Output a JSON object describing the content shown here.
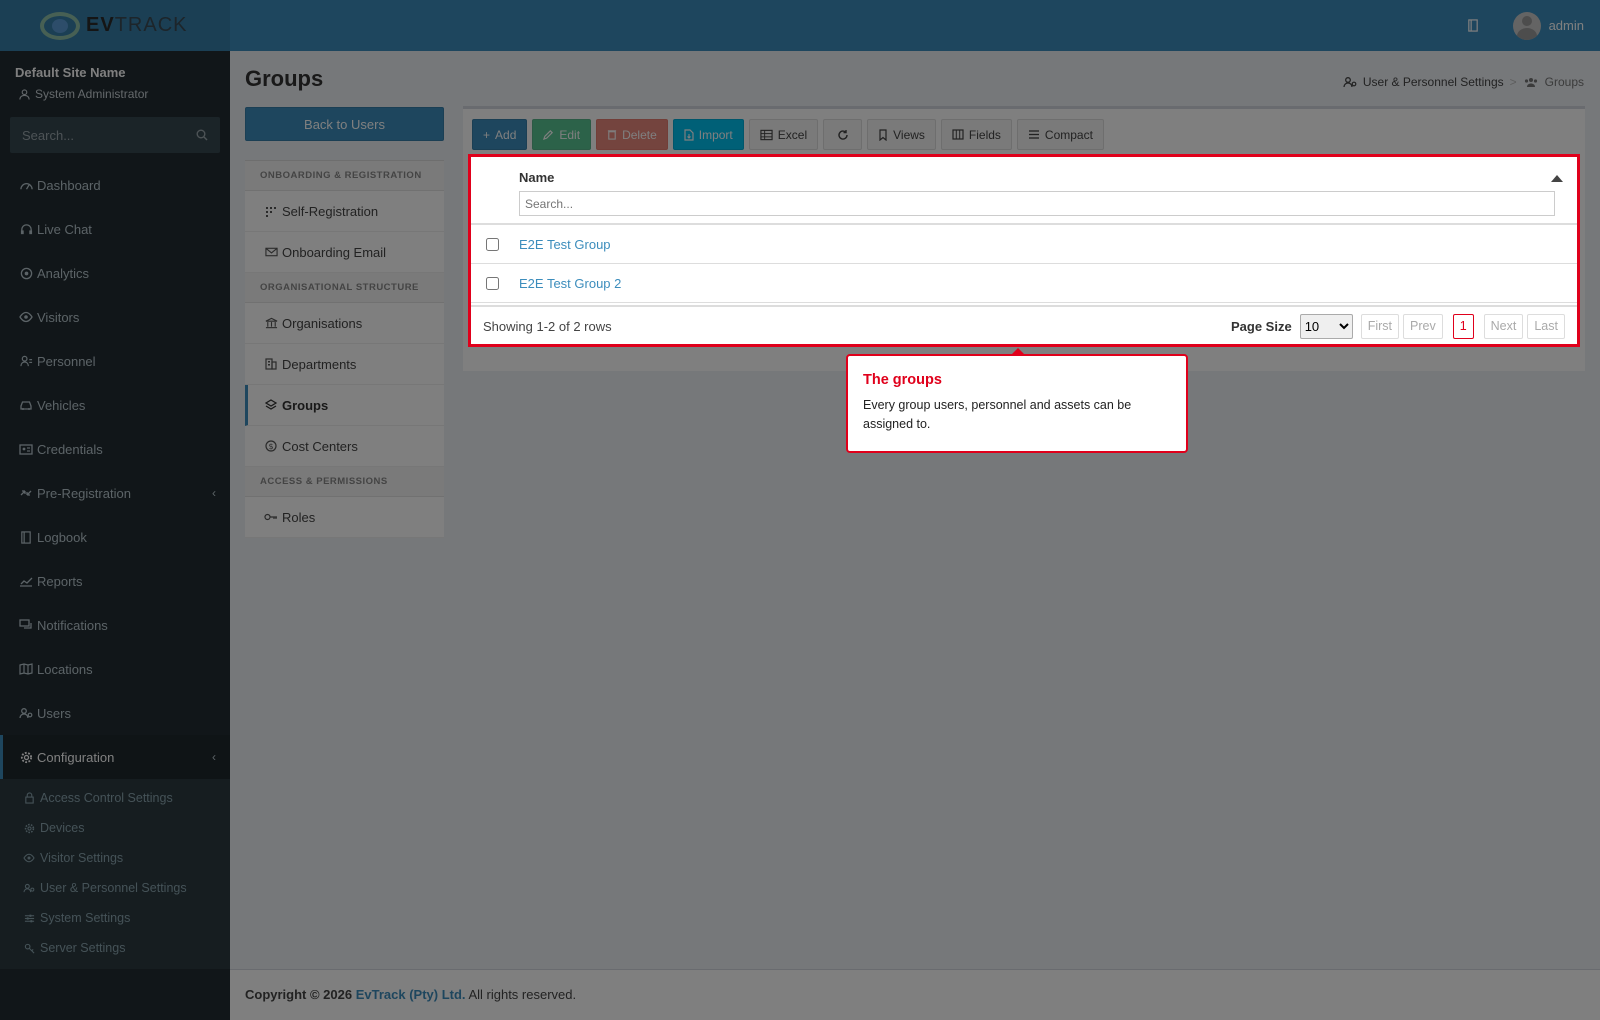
{
  "brand": {
    "logo_bold": "EV",
    "logo_light": "TRACK"
  },
  "header": {
    "user_name": "admin",
    "icon_book": "book-icon"
  },
  "user_panel": {
    "site_name": "Default Site Name",
    "role": "System Administrator"
  },
  "sidebar": {
    "search_placeholder": "Search...",
    "items": [
      {
        "label": "Dashboard",
        "icon": "dashboard-icon"
      },
      {
        "label": "Live Chat",
        "icon": "headset-icon"
      },
      {
        "label": "Analytics",
        "icon": "analytics-icon"
      },
      {
        "label": "Visitors",
        "icon": "eye-icon"
      },
      {
        "label": "Personnel",
        "icon": "personnel-icon"
      },
      {
        "label": "Vehicles",
        "icon": "car-icon"
      },
      {
        "label": "Credentials",
        "icon": "id-card-icon"
      },
      {
        "label": "Pre-Registration",
        "icon": "arrows-icon"
      },
      {
        "label": "Logbook",
        "icon": "book-icon"
      },
      {
        "label": "Reports",
        "icon": "chart-icon"
      },
      {
        "label": "Notifications",
        "icon": "chat-icon"
      },
      {
        "label": "Locations",
        "icon": "map-icon"
      },
      {
        "label": "Users",
        "icon": "users-icon"
      },
      {
        "label": "Configuration",
        "icon": "gear-icon"
      }
    ],
    "config_sub": [
      {
        "label": "Access Control Settings"
      },
      {
        "label": "Devices"
      },
      {
        "label": "Visitor Settings"
      },
      {
        "label": "User & Personnel Settings"
      },
      {
        "label": "System Settings"
      },
      {
        "label": "Server Settings"
      }
    ]
  },
  "page": {
    "title": "Groups",
    "breadcrumb": [
      "User & Personnel Settings",
      "Groups"
    ],
    "back_button": "Back to Users"
  },
  "side_nav": {
    "sections": [
      {
        "header": "ONBOARDING & REGISTRATION",
        "links": [
          "Self-Registration",
          "Onboarding Email"
        ]
      },
      {
        "header": "ORGANISATIONAL STRUCTURE",
        "links": [
          "Organisations",
          "Departments",
          "Groups",
          "Cost Centers"
        ]
      },
      {
        "header": "ACCESS & PERMISSIONS",
        "links": [
          "Roles"
        ]
      }
    ]
  },
  "toolbar": {
    "add": "Add",
    "edit": "Edit",
    "delete": "Delete",
    "import": "Import",
    "excel": "Excel",
    "views": "Views",
    "fields": "Fields",
    "compact": "Compact"
  },
  "grid": {
    "column": "Name",
    "search_placeholder": "Search...",
    "rows": [
      "E2E Test Group",
      "E2E Test Group 2"
    ],
    "showing": "Showing 1-2 of 2 rows",
    "page_size_label": "Page Size",
    "page_size": "10",
    "pager": {
      "first": "First",
      "prev": "Prev",
      "current": "1",
      "next": "Next",
      "last": "Last"
    }
  },
  "tooltip": {
    "title": "The groups",
    "text": "Every group users, personnel and assets can be assigned to."
  },
  "footer": {
    "prefix": "Copyright © 2026",
    "company": "EvTrack (Pty) Ltd.",
    "suffix": "All rights reserved."
  },
  "colors": {
    "accent": "#3c8dbc",
    "sidebar": "#222d32",
    "highlight": "#e0001b"
  }
}
